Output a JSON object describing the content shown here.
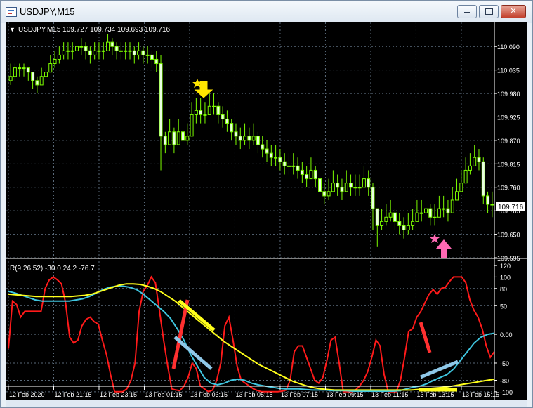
{
  "window": {
    "title": "USDJPY,M15"
  },
  "symbol_header": {
    "arrow": "▼",
    "text": "USDJPY,M15  109.727 109.734 109.693 109.716"
  },
  "oscillator_header": "R(9,26,52) -30.0 24.2 -76.7",
  "current_price_label": "109.716",
  "colors": {
    "background": "#000000",
    "grid": "#5a6a7a",
    "candles": "#7cfc00",
    "bear_body": "#e8ffe0",
    "fast_line": "#ff1a1a",
    "mid_line": "#3fc6e0",
    "slow_line": "#ffff1a",
    "arrow_down": "#ffe600",
    "arrow_up": "#ff69b4"
  },
  "chart_data": [
    {
      "type": "candlestick",
      "symbol": "USDJPY",
      "timeframe": "M15",
      "y_ticks": [
        "110.090",
        "110.035",
        "109.980",
        "109.925",
        "109.870",
        "109.815",
        "109.760",
        "109.705",
        "109.650",
        "109.595"
      ],
      "ylim": [
        109.595,
        110.12
      ],
      "x_ticks": [
        "12 Feb 2020",
        "12 Feb 21:15",
        "12 Feb 23:15",
        "13 Feb 01:15",
        "13 Feb 03:15",
        "13 Feb 05:15",
        "13 Feb 07:15",
        "13 Feb 09:15",
        "13 Feb 11:15",
        "13 Feb 13:15",
        "13 Feb 15:15"
      ],
      "last_price": 109.716,
      "close": [
        110.02,
        110.04,
        110.04,
        110.04,
        110.03,
        110.01,
        110.0,
        110.02,
        110.03,
        110.05,
        110.06,
        110.07,
        110.08,
        110.08,
        110.08,
        110.09,
        110.09,
        110.08,
        110.07,
        110.08,
        110.08,
        110.08,
        110.1,
        110.09,
        110.08,
        110.08,
        110.08,
        110.08,
        110.07,
        110.08,
        110.07,
        110.07,
        110.06,
        110.05,
        109.88,
        109.86,
        109.89,
        109.86,
        109.89,
        109.87,
        109.88,
        109.93,
        109.94,
        109.93,
        109.93,
        109.95,
        109.95,
        109.93,
        109.92,
        109.91,
        109.89,
        109.88,
        109.87,
        109.88,
        109.87,
        109.88,
        109.86,
        109.85,
        109.84,
        109.83,
        109.83,
        109.82,
        109.81,
        109.81,
        109.81,
        109.8,
        109.79,
        109.78,
        109.8,
        109.78,
        109.75,
        109.74,
        109.75,
        109.77,
        109.76,
        109.75,
        109.77,
        109.76,
        109.76,
        109.76,
        109.78,
        109.76,
        109.71,
        109.67,
        109.68,
        109.69,
        109.7,
        109.68,
        109.67,
        109.66,
        109.67,
        109.68,
        109.7,
        109.7,
        109.71,
        109.69,
        109.69,
        109.71,
        109.71,
        109.7,
        109.73,
        109.75,
        109.77,
        109.8,
        109.81,
        109.83,
        109.82,
        109.74,
        109.72,
        109.72
      ],
      "high": [
        110.05,
        110.05,
        110.05,
        110.05,
        110.04,
        110.03,
        110.02,
        110.04,
        110.05,
        110.07,
        110.08,
        110.09,
        110.1,
        110.1,
        110.1,
        110.11,
        110.11,
        110.1,
        110.09,
        110.1,
        110.1,
        110.1,
        110.12,
        110.11,
        110.1,
        110.1,
        110.1,
        110.1,
        110.09,
        110.1,
        110.09,
        110.09,
        110.08,
        110.08,
        110.07,
        109.89,
        109.92,
        109.9,
        109.92,
        109.9,
        109.91,
        109.96,
        109.97,
        109.97,
        109.96,
        109.98,
        109.98,
        109.96,
        109.95,
        109.94,
        109.92,
        109.91,
        109.9,
        109.91,
        109.9,
        109.91,
        109.89,
        109.88,
        109.87,
        109.86,
        109.86,
        109.85,
        109.84,
        109.84,
        109.84,
        109.83,
        109.82,
        109.81,
        109.83,
        109.81,
        109.79,
        109.77,
        109.78,
        109.8,
        109.79,
        109.78,
        109.8,
        109.79,
        109.79,
        109.79,
        109.81,
        109.8,
        109.77,
        109.71,
        109.71,
        109.72,
        109.73,
        109.71,
        109.7,
        109.69,
        109.7,
        109.71,
        109.73,
        109.73,
        109.74,
        109.72,
        109.72,
        109.74,
        109.74,
        109.73,
        109.76,
        109.78,
        109.8,
        109.83,
        109.84,
        109.86,
        109.85,
        109.83,
        109.75,
        109.75
      ],
      "low": [
        110.0,
        110.01,
        110.02,
        110.02,
        110.01,
        109.99,
        109.98,
        110.0,
        110.01,
        110.03,
        110.04,
        110.05,
        110.06,
        110.06,
        110.06,
        110.07,
        110.07,
        110.06,
        110.05,
        110.06,
        110.06,
        110.06,
        110.08,
        110.07,
        110.06,
        110.06,
        110.06,
        110.06,
        110.05,
        110.06,
        110.05,
        110.05,
        110.04,
        110.03,
        109.8,
        109.84,
        109.86,
        109.84,
        109.86,
        109.85,
        109.86,
        109.9,
        109.91,
        109.91,
        109.91,
        109.93,
        109.93,
        109.91,
        109.9,
        109.89,
        109.87,
        109.86,
        109.85,
        109.86,
        109.85,
        109.86,
        109.84,
        109.83,
        109.82,
        109.81,
        109.81,
        109.8,
        109.79,
        109.79,
        109.79,
        109.78,
        109.77,
        109.76,
        109.78,
        109.76,
        109.73,
        109.72,
        109.73,
        109.75,
        109.74,
        109.73,
        109.75,
        109.74,
        109.74,
        109.74,
        109.76,
        109.74,
        109.66,
        109.62,
        109.66,
        109.67,
        109.68,
        109.66,
        109.65,
        109.64,
        109.65,
        109.66,
        109.68,
        109.68,
        109.69,
        109.67,
        109.67,
        109.69,
        109.69,
        109.68,
        109.71,
        109.73,
        109.75,
        109.78,
        109.79,
        109.81,
        109.8,
        109.72,
        109.7,
        109.69
      ]
    },
    {
      "type": "line",
      "title": "R(9,26,52) -30.0 24.2 -76.7",
      "y_ticks": [
        "120",
        "100",
        "80",
        "50",
        "0.00",
        "-50",
        "-80",
        "-100"
      ],
      "ylim": [
        -110,
        125
      ],
      "series": [
        {
          "name": "R9",
          "color": "#ff1a1a",
          "values": [
            -25,
            58,
            52,
            30,
            40,
            40,
            40,
            40,
            40,
            80,
            95,
            100,
            95,
            88,
            55,
            -5,
            -15,
            -10,
            15,
            26,
            30,
            22,
            18,
            -10,
            -35,
            -70,
            -100,
            -100,
            -100,
            -95,
            -80,
            -50,
            40,
            75,
            85,
            100,
            90,
            40,
            -10,
            -55,
            -95,
            -97,
            -98,
            -90,
            -75,
            -50,
            -60,
            -90,
            -95,
            -100,
            -97,
            -80,
            -50,
            15,
            30,
            -10,
            -55,
            -80,
            -85,
            -90,
            -95,
            -98,
            -100,
            -100,
            -100,
            -100,
            -100,
            -99,
            -97,
            -80,
            -30,
            -20,
            -20,
            -40,
            -60,
            -80,
            -85,
            -75,
            -45,
            -10,
            -5,
            -50,
            -100,
            -100,
            -100,
            -97,
            -90,
            -80,
            -65,
            -40,
            -10,
            -20,
            -70,
            -100,
            -100,
            -100,
            -80,
            -40,
            5,
            10,
            30,
            40,
            55,
            70,
            78,
            70,
            80,
            82,
            92,
            100,
            100,
            100,
            90,
            60,
            42,
            30,
            10,
            -20,
            -40,
            -30
          ]
        },
        {
          "name": "R26",
          "color": "#3fc6e0",
          "values": [
            75,
            72,
            68,
            64,
            60,
            58,
            58,
            58,
            58,
            58,
            60,
            62,
            66,
            72,
            78,
            82,
            84,
            84,
            82,
            78,
            70,
            60,
            50,
            40,
            28,
            10,
            -10,
            -35,
            -55,
            -75,
            -85,
            -88,
            -85,
            -80,
            -78,
            -80,
            -85,
            -88,
            -90,
            -92,
            -94,
            -95,
            -95,
            -95,
            -96,
            -97,
            -97,
            -97,
            -98,
            -98,
            -98,
            -99,
            -99,
            -99,
            -99,
            -99,
            -99,
            -99,
            -98,
            -95,
            -92,
            -90,
            -86,
            -80,
            -75,
            -70,
            -60,
            -45,
            -30,
            -15,
            -5,
            0,
            2
          ]
        },
        {
          "name": "R52",
          "color": "#ffff1a",
          "values": [
            70,
            69,
            68,
            67,
            66,
            66,
            66,
            66,
            66,
            66,
            67,
            68,
            70,
            74,
            78,
            82,
            86,
            88,
            88,
            87,
            84,
            80,
            74,
            66,
            58,
            48,
            38,
            28,
            18,
            8,
            -2,
            -12,
            -20,
            -28,
            -36,
            -44,
            -52,
            -58,
            -64,
            -70,
            -76,
            -82,
            -86,
            -90,
            -93,
            -95,
            -96,
            -97,
            -97,
            -97,
            -97,
            -97,
            -97,
            -97,
            -97,
            -97,
            -97,
            -97,
            -97,
            -96,
            -95,
            -94,
            -93,
            -92,
            -90,
            -88,
            -86,
            -84,
            -82,
            -80,
            -78
          ]
        }
      ]
    }
  ]
}
